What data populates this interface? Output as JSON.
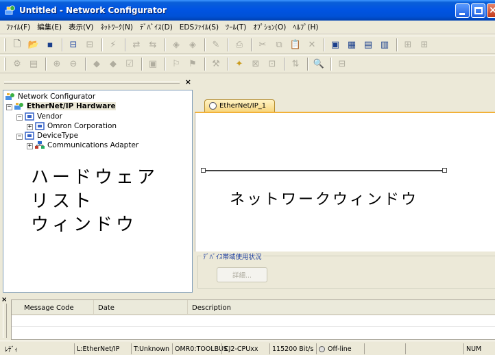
{
  "window": {
    "title": "Untitled - Network Configurator"
  },
  "menu": [
    {
      "label": "ﾌｧｲﾙ(F)"
    },
    {
      "label": "編集(E)"
    },
    {
      "label": "表示(V)"
    },
    {
      "label": "ﾈｯﾄﾜｰｸ(N)"
    },
    {
      "label": "ﾃﾞﾊﾞｲｽ(D)"
    },
    {
      "label": "EDSﾌｧｲﾙ(S)"
    },
    {
      "label": "ﾂｰﾙ(T)"
    },
    {
      "label": "ｵﾌﾟｼｮﾝ(O)"
    },
    {
      "label": "ﾍﾙﾌﾟ(H)"
    }
  ],
  "tree": {
    "root": "Network Configurator",
    "hardware": "EtherNet/IP Hardware",
    "vendor": "Vendor",
    "omron": "Omron Corporation",
    "devicetype": "DeviceType",
    "comm": "Communications Adapter"
  },
  "annotations": {
    "hardware_line1": "ハードウェア",
    "hardware_line2": "リスト",
    "hardware_line3": "ウィンドウ",
    "network_window": "ネットワークウィンドウ"
  },
  "network": {
    "tab_label": "EtherNet/IP_1"
  },
  "usage": {
    "legend": "ﾃﾞﾊﾞｲｽ帯域使用状況",
    "detail_button": "詳細..."
  },
  "messages": {
    "col_code": "Message Code",
    "col_date": "Date",
    "col_desc": "Description"
  },
  "status": {
    "ready": "ﾚﾃﾞｨ",
    "network_type": "L:EtherNet/IP",
    "target": "T:Unknown",
    "route": "OMR0:TOOLBUS",
    "cpu": "CJ2-CPUxx",
    "baud": "115200 Bit/s",
    "connection": "Off-line",
    "num": "NUM"
  },
  "colors": {
    "titlebar": "#0054e3",
    "accent_tab": "#f2b138",
    "panel_bg": "#ece9d8"
  }
}
